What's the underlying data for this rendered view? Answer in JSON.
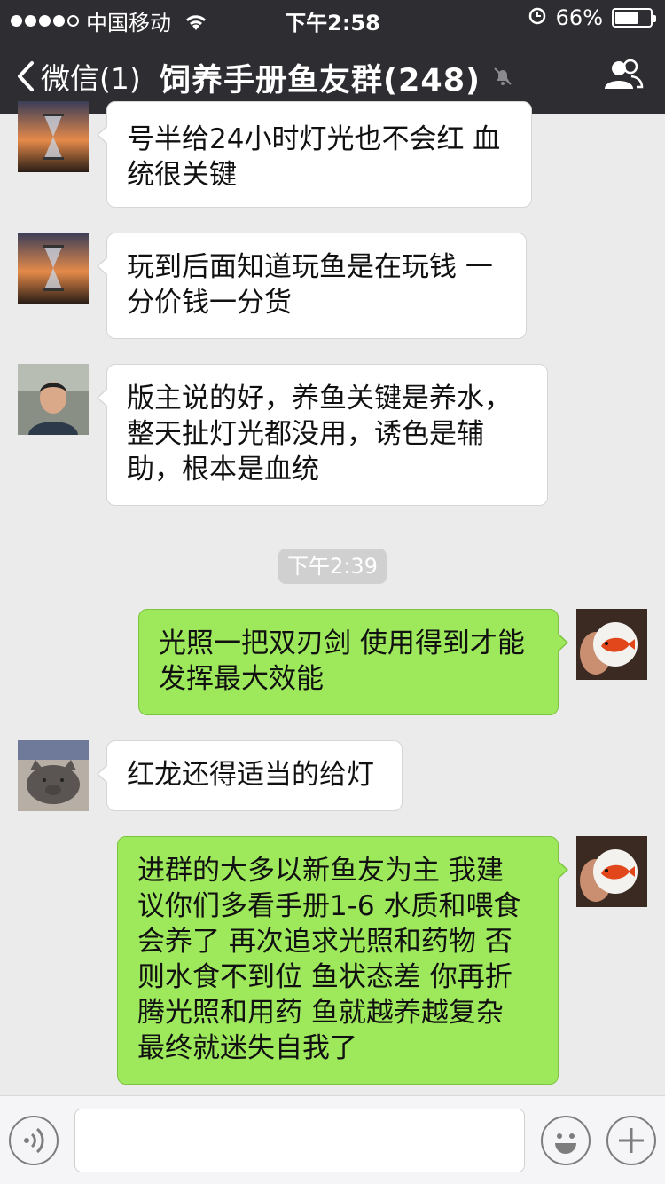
{
  "status_bar": {
    "carrier": "中国移动",
    "time": "下午2:58",
    "battery": "66%",
    "battery_level": 0.66,
    "signal_bars": 4
  },
  "nav": {
    "back_label": "微信(1)",
    "title": "饲养手册鱼友群(248)"
  },
  "messages": [
    {
      "side": "left",
      "text": "号半给24小时灯光也不会红 血\n统很关键",
      "avatar": "hourglass-sunset"
    },
    {
      "side": "left",
      "text": "玩到后面知道玩鱼是在玩钱 一\n分价钱一分货",
      "avatar": "hourglass-sunset"
    },
    {
      "side": "left",
      "text": "版主说的好，养鱼关键是养水，\n整天扯灯光都没用，诱色是辅\n助，根本是血统",
      "avatar": "man-portrait"
    },
    {
      "side": "right",
      "text": "光照一把双刃剑 使用得到才能\n发挥最大效能",
      "avatar": "red-arowana-badge"
    },
    {
      "side": "left",
      "text": "红龙还得适当的给灯",
      "avatar": "clay-pig"
    },
    {
      "side": "right",
      "text": "进群的大多以新鱼友为主 我建\n议你们多看手册1-6 水质和喂食\n会养了 再次追求光照和药物 否\n则水食不到位 鱼状态差 你再折\n腾光照和用药 鱼就越养越复杂\n最终就迷失自我了",
      "avatar": "red-arowana-badge"
    }
  ],
  "timestamp": "下午2:39",
  "input_bar": {
    "value": "",
    "icons": [
      "voice-icon",
      "emoji-icon",
      "plus-icon"
    ]
  },
  "colors": {
    "nav_bg": "#2e2e32",
    "chat_bg": "#ebebeb",
    "bubble_self": "#9de85b",
    "bubble_other": "#ffffff"
  }
}
